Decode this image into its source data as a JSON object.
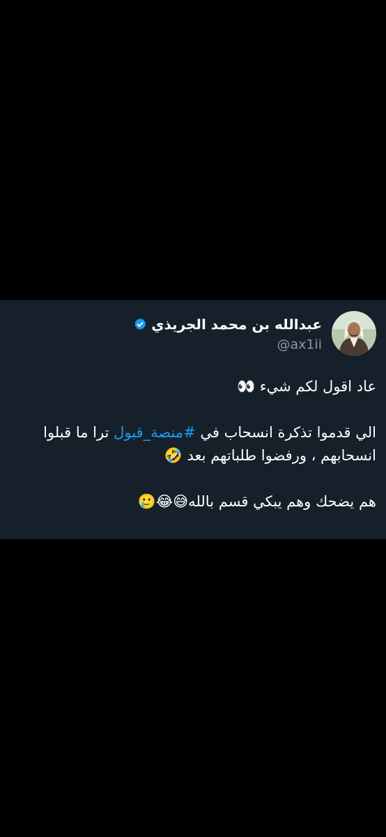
{
  "tweet": {
    "author": {
      "display_name": "عبدالله بن محمد الجريذي",
      "handle": "@ax1ii",
      "verified": true,
      "avatar_icon": "profile-photo"
    },
    "text": {
      "line1": "عاد اقول لكم شيء 👀",
      "line2_before": "الي قدموا تذكرة انسحاب في ",
      "hashtag": "#منصة_قبول",
      "line2_after": " ترا ما قبلوا انسحابهم ، ورفضوا طلباتهم بعد 🤣",
      "line3": "هم يضحك وهم يبكي قسم بالله😅😂🥲"
    }
  },
  "colors": {
    "background": "#000000",
    "card": "#15202b",
    "text": "#ffffff",
    "secondary": "#8b98a5",
    "link": "#1d9bf0",
    "verified": "#1d9bf0"
  }
}
